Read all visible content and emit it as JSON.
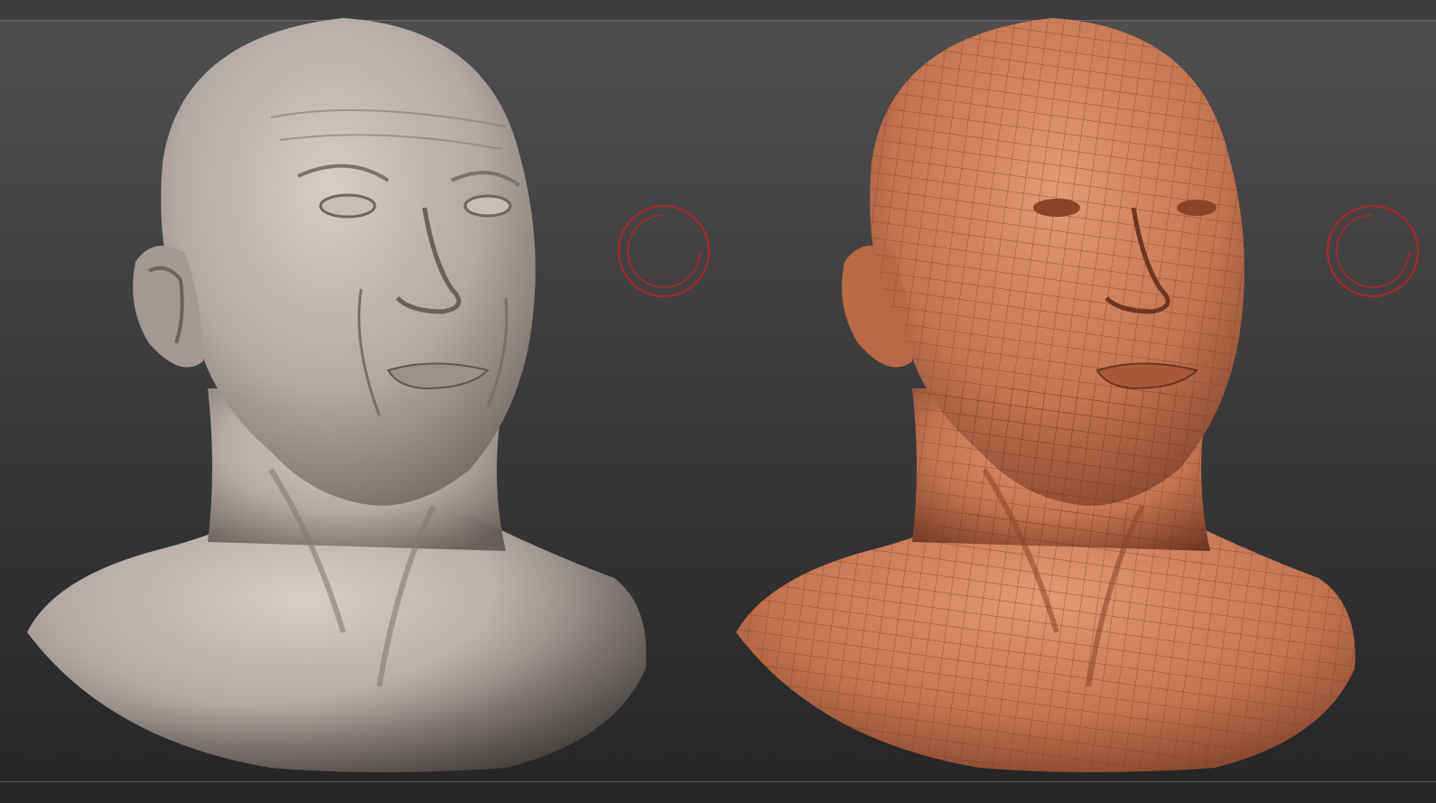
{
  "viewport": {
    "background_top": "#4e4e4e",
    "background_bottom": "#262626"
  },
  "models": [
    {
      "id": "sculpt",
      "kind": "sculpted-bust",
      "material_color": "#b5aaa5"
    },
    {
      "id": "retopo",
      "kind": "wireframe-bust",
      "material_color": "#c87a55",
      "wire_color": "#7a3a20"
    }
  ],
  "widgets": {
    "gizmo_color": "#b3262a"
  }
}
